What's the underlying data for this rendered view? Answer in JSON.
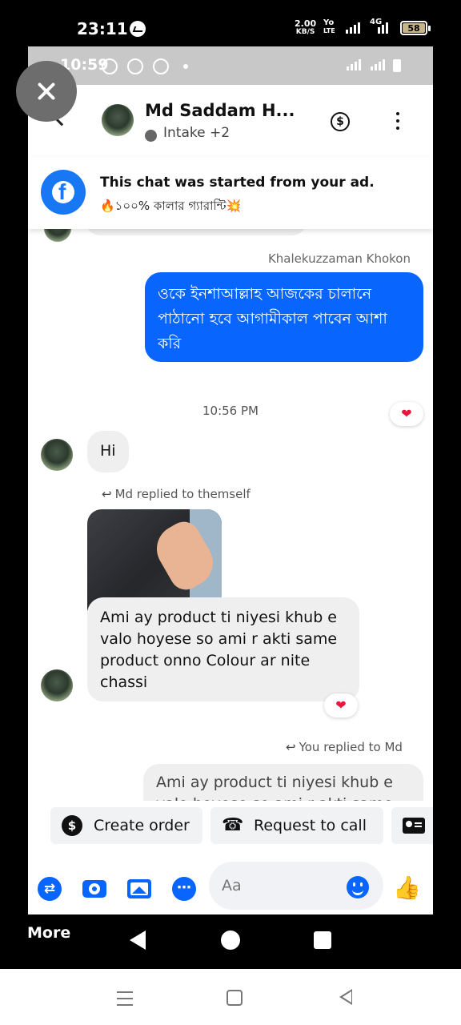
{
  "outer_status": {
    "time": "23:11",
    "net_speed_value": "2.00",
    "net_speed_unit": "KB/S",
    "volte_top": "Yo",
    "volte_bottom": "LTE",
    "network": "4G",
    "battery": "58",
    "icons": [
      "messenger-notification-icon",
      "signal-icon",
      "battery-icon"
    ]
  },
  "inner_status": {
    "time": "10:59"
  },
  "header": {
    "contact_name": "Md Saddam H...",
    "subtitle": "Intake +2",
    "icons": [
      "back-icon",
      "dollar-icon",
      "more-icon"
    ]
  },
  "ad_banner": {
    "title": "This chat was started from your ad.",
    "subtitle": "🔥১০০% কালার গ্যারান্টি💥"
  },
  "thread": {
    "sender_name": "Khalekuzzaman Khokon",
    "outgoing_message": "ওকে ইনশাআল্লাহ আজকের চালানে পাঠানো হবে আগামীকাল পাবেন আশা করি",
    "reaction": "❤",
    "time_divider": "10:56 PM",
    "incoming_hi": "Hi",
    "reply_label_md": "Md replied to themself",
    "incoming_long": "Ami ay product ti niyesi khub e valo hoyese so ami r akti same product onno Colour ar nite chassi",
    "reply_label_you": "You replied to Md",
    "quoted_preview": "Ami ay product ti niyesi khub e valo hoyese so ami r akti same"
  },
  "quick_actions": {
    "create_order": "Create order",
    "request_call": "Request to call"
  },
  "composer": {
    "placeholder": "Aa"
  },
  "bottom_nav": {
    "more_label": "More"
  },
  "colors": {
    "messenger_blue": "#0866ff",
    "facebook_blue": "#1877f2",
    "incoming_bubble": "#efefef",
    "heart": "#e8173c"
  }
}
